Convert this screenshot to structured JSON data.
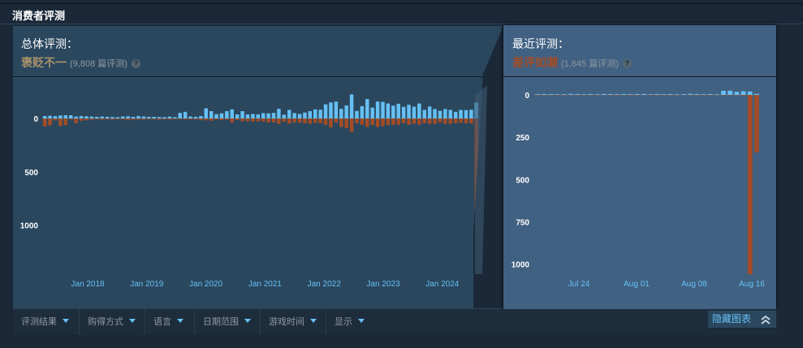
{
  "section": {
    "title": "消费者评测"
  },
  "overall": {
    "label": "总体评测：",
    "summary": "褒贬不一",
    "summary_color": "#a8926a",
    "count": "(9,808 篇评测)",
    "help_icon": "question-mark"
  },
  "recent": {
    "label": "最近评测：",
    "summary": "差评如潮",
    "summary_color": "#a34c25",
    "count": "(1,645 篇评测)",
    "help_icon": "question-mark"
  },
  "colors": {
    "positive": "#66c0f4",
    "negative": "#a34c25"
  },
  "chart_data": [
    {
      "type": "bar",
      "x_ticks": [
        "Jan 2018",
        "Jan 2019",
        "Jan 2020",
        "Jan 2021",
        "Jan 2022",
        "Jan 2023",
        "Jan 2024"
      ],
      "y_ticks": [
        "0",
        "500",
        "1000"
      ],
      "y_zero_label": "0",
      "ylim": [
        -1500,
        250
      ],
      "series": [
        {
          "values": [
            22,
            25,
            22,
            28,
            30,
            30,
            18,
            22,
            20,
            18,
            15,
            18,
            15,
            14,
            12,
            18,
            20,
            15,
            22,
            18,
            15,
            15,
            13,
            12,
            17,
            12,
            52,
            62,
            18,
            15,
            22,
            95,
            68,
            40,
            48,
            68,
            85,
            38,
            68,
            38,
            42,
            38,
            50,
            48,
            52,
            90,
            35,
            80,
            50,
            42,
            55,
            68,
            85,
            82,
            132,
            150,
            158,
            90,
            122,
            225,
            70,
            115,
            182,
            102,
            158,
            155,
            140,
            120,
            138,
            108,
            128,
            110,
            140,
            80,
            112,
            88,
            72,
            88,
            80,
            62,
            80,
            78,
            82,
            150
          ]
        },
        {
          "values": [
            75,
            65,
            18,
            70,
            62,
            10,
            45,
            22,
            18,
            12,
            8,
            12,
            10,
            12,
            8,
            10,
            18,
            12,
            10,
            12,
            8,
            9,
            12,
            10,
            10,
            8,
            8,
            10,
            10,
            10,
            15,
            18,
            22,
            10,
            15,
            12,
            38,
            15,
            25,
            28,
            28,
            28,
            30,
            38,
            38,
            52,
            30,
            48,
            38,
            40,
            45,
            50,
            42,
            45,
            60,
            85,
            40,
            80,
            90,
            125,
            45,
            60,
            80,
            62,
            80,
            72,
            62,
            60,
            58,
            45,
            60,
            50,
            58,
            45,
            52,
            52,
            38,
            52,
            50,
            45,
            42,
            45,
            48,
            1480
          ]
        }
      ]
    },
    {
      "type": "bar",
      "x_ticks": [
        "Jul 24",
        "Aug 01",
        "Aug 08",
        "Aug 16"
      ],
      "y_ticks": [
        "0",
        "250",
        "500",
        "750",
        "1000"
      ],
      "ylim": [
        -1060,
        30
      ],
      "series": [
        {
          "values": [
            4,
            5,
            5,
            4,
            4,
            6,
            5,
            4,
            5,
            4,
            6,
            5,
            4,
            5,
            4,
            5,
            6,
            4,
            5,
            4,
            5,
            4,
            5,
            6,
            5,
            4,
            5,
            4,
            24,
            25,
            18,
            22,
            20,
            6
          ]
        },
        {
          "values": [
            3,
            3,
            2,
            3,
            3,
            2,
            3,
            3,
            2,
            3,
            2,
            3,
            3,
            2,
            3,
            3,
            2,
            3,
            3,
            2,
            3,
            3,
            2,
            3,
            2,
            3,
            3,
            2,
            3,
            3,
            2,
            5,
            1060,
            340
          ]
        }
      ]
    }
  ],
  "filters": [
    {
      "label": "评测结果"
    },
    {
      "label": "购得方式"
    },
    {
      "label": "语言"
    },
    {
      "label": "日期范围"
    },
    {
      "label": "游戏时间"
    },
    {
      "label": "显示"
    }
  ],
  "hide_graph": {
    "label": "隐藏图表",
    "icon": "double-chevron-up-icon"
  }
}
